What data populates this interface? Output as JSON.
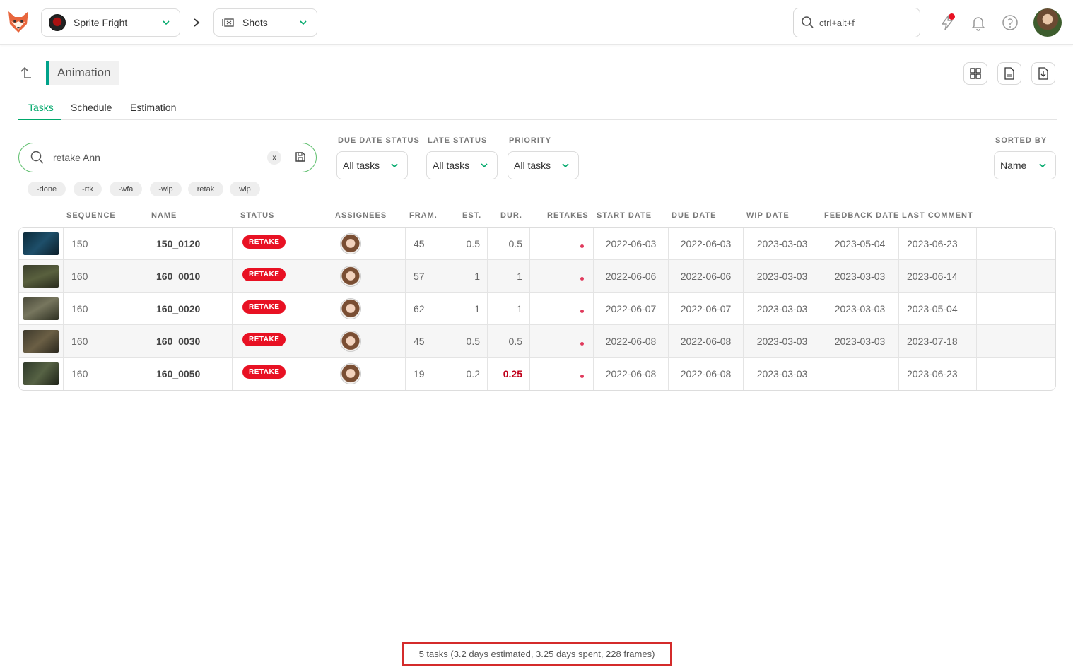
{
  "topbar": {
    "production": "Sprite Fright",
    "section": "Shots",
    "search_placeholder": "ctrl+alt+f"
  },
  "header": {
    "title": "Animation"
  },
  "tabs": [
    {
      "label": "Tasks",
      "active": true
    },
    {
      "label": "Schedule",
      "active": false
    },
    {
      "label": "Estimation",
      "active": false
    }
  ],
  "search": {
    "value": "retake Ann",
    "clear_label": "x"
  },
  "chips": [
    "-done",
    "-rtk",
    "-wfa",
    "-wip",
    "retak",
    "wip"
  ],
  "filters": {
    "due_date_status": {
      "label": "DUE DATE STATUS",
      "value": "All tasks"
    },
    "late_status": {
      "label": "LATE STATUS",
      "value": "All tasks"
    },
    "priority": {
      "label": "PRIORITY",
      "value": "All tasks"
    },
    "sorted_by": {
      "label": "SORTED BY",
      "value": "Name"
    }
  },
  "columns": {
    "sequence": "SEQUENCE",
    "name": "NAME",
    "status": "STATUS",
    "assignees": "ASSIGNEES",
    "frames": "FRAM.",
    "est": "EST.",
    "dur": "DUR.",
    "retakes": "RETAKES",
    "start_date": "START DATE",
    "due_date": "DUE DATE",
    "wip_date": "WIP DATE",
    "feedback_date": "FEEDBACK DATE",
    "last_comment": "LAST COMMENT"
  },
  "rows": [
    {
      "sequence": "150",
      "name": "150_0120",
      "status": "RETAKE",
      "frames": "45",
      "est": "0.5",
      "dur": "0.5",
      "start": "2022-06-03",
      "due": "2022-06-03",
      "wip": "2023-03-03",
      "feedback": "2023-05-04",
      "last_comment": "2023-06-23"
    },
    {
      "sequence": "160",
      "name": "160_0010",
      "status": "RETAKE",
      "frames": "57",
      "est": "1",
      "dur": "1",
      "start": "2022-06-06",
      "due": "2022-06-06",
      "wip": "2023-03-03",
      "feedback": "2023-03-03",
      "last_comment": "2023-06-14"
    },
    {
      "sequence": "160",
      "name": "160_0020",
      "status": "RETAKE",
      "frames": "62",
      "est": "1",
      "dur": "1",
      "start": "2022-06-07",
      "due": "2022-06-07",
      "wip": "2023-03-03",
      "feedback": "2023-03-03",
      "last_comment": "2023-05-04"
    },
    {
      "sequence": "160",
      "name": "160_0030",
      "status": "RETAKE",
      "frames": "45",
      "est": "0.5",
      "dur": "0.5",
      "start": "2022-06-08",
      "due": "2022-06-08",
      "wip": "2023-03-03",
      "feedback": "2023-03-03",
      "last_comment": "2023-07-18"
    },
    {
      "sequence": "160",
      "name": "160_0050",
      "status": "RETAKE",
      "frames": "19",
      "est": "0.2",
      "dur": "0.25",
      "start": "2022-06-08",
      "due": "2022-06-08",
      "wip": "2023-03-03",
      "feedback": "",
      "last_comment": "2023-06-23"
    }
  ],
  "summary": "5 tasks (3.2 days estimated, 3.25 days spent, 228 frames)",
  "colors": {
    "accent": "#00a86b",
    "retake": "#e81123",
    "late_duration": "#c0001a"
  }
}
